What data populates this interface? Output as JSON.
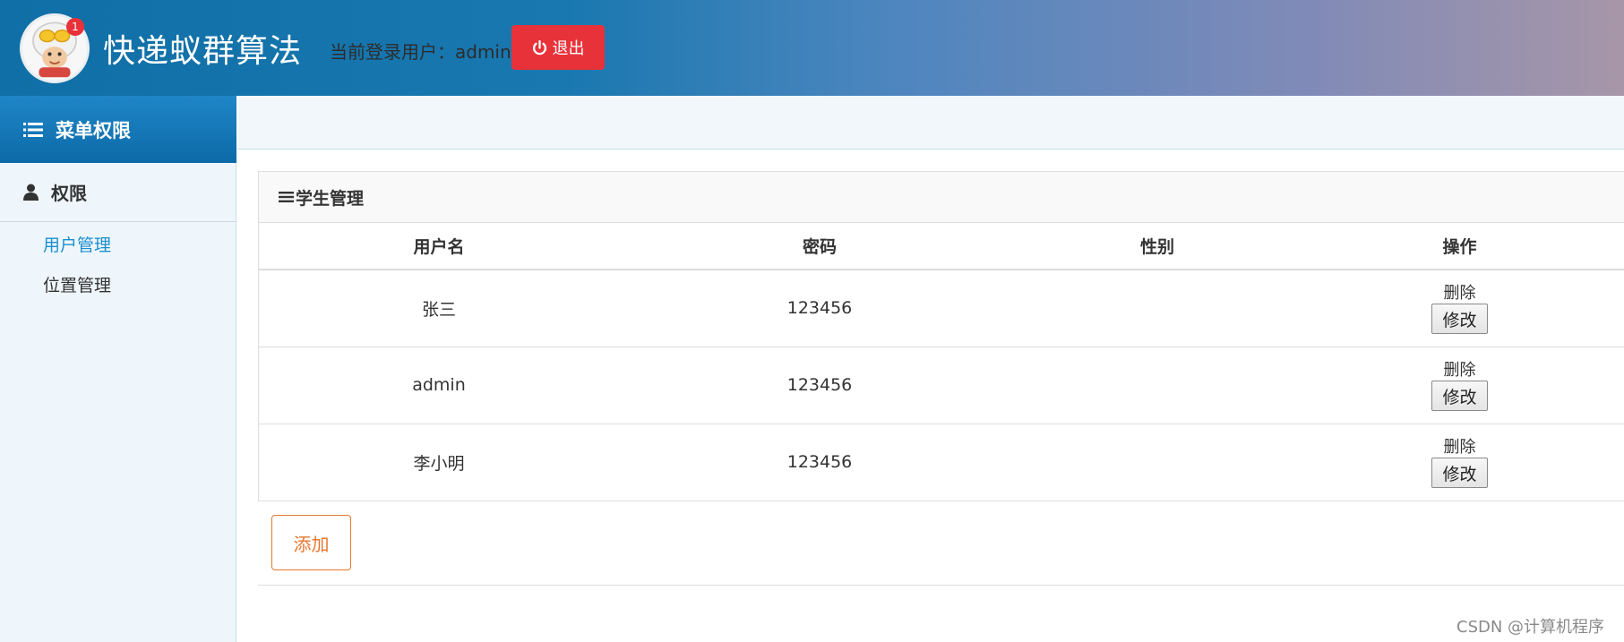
{
  "header": {
    "badge_count": "1",
    "app_title": "快递蚁群算法",
    "login_label": "当前登录用户：",
    "login_user": "admin",
    "logout_label": "退出"
  },
  "sidebar": {
    "header_label": "菜单权限",
    "group_label": "权限",
    "items": [
      {
        "label": "用户管理",
        "active": true
      },
      {
        "label": "位置管理",
        "active": false
      }
    ]
  },
  "panel": {
    "title": "学生管理",
    "columns": [
      "用户名",
      "密码",
      "性别",
      "操作"
    ],
    "rows": [
      {
        "username": "张三",
        "password": "123456",
        "gender": "",
        "delete_label": "删除",
        "edit_label": "修改"
      },
      {
        "username": "admin",
        "password": "123456",
        "gender": "",
        "delete_label": "删除",
        "edit_label": "修改"
      },
      {
        "username": "李小明",
        "password": "123456",
        "gender": "",
        "delete_label": "删除",
        "edit_label": "修改"
      }
    ],
    "add_label": "添加"
  },
  "watermark": "CSDN @计算机程序",
  "colors": {
    "header_gradient_start": "#0f6fa6",
    "header_gradient_end": "#a796a8",
    "logout_bg": "#e8323a",
    "sidebar_header_bg": "#1f86c7",
    "active_link": "#1b8fd0",
    "add_button": "#e8772e"
  }
}
